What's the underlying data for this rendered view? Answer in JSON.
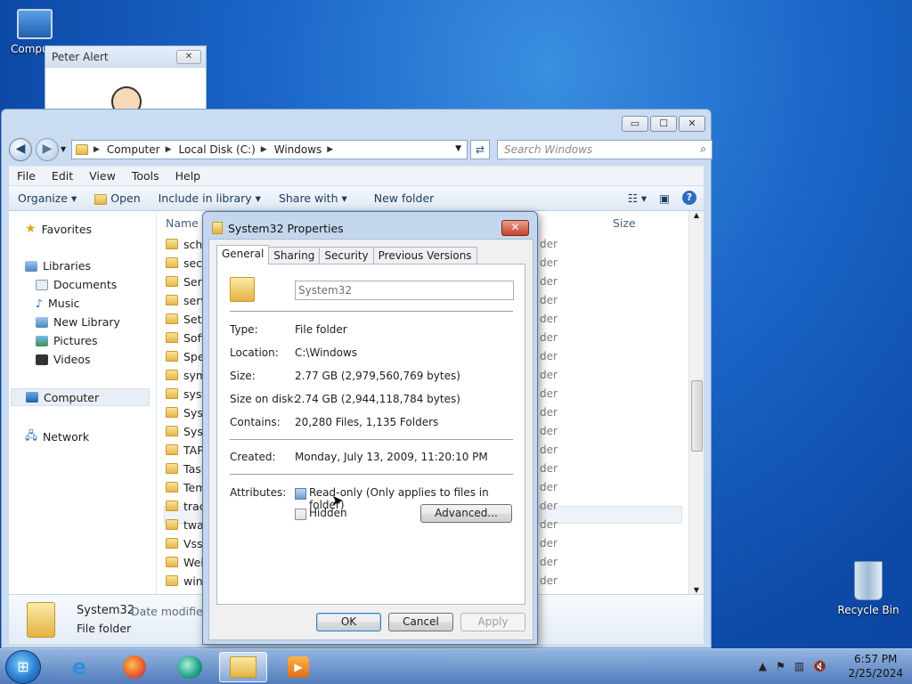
{
  "desktop": {
    "icons": [
      {
        "label": "Computer",
        "visible_label": "Compu"
      },
      {
        "label": "Recycle Bin"
      }
    ]
  },
  "peter_window": {
    "title": "Peter Alert",
    "close": "✕"
  },
  "explorer": {
    "controls": {
      "minimize": "▭",
      "maximize": "☐",
      "close": "✕"
    },
    "address": [
      "Computer",
      "Local Disk (C:)",
      "Windows"
    ],
    "search_placeholder": "Search Windows",
    "menu": [
      "File",
      "Edit",
      "View",
      "Tools",
      "Help"
    ],
    "toolbar": {
      "organize": "Organize ▾",
      "open": "Open",
      "include": "Include in library ▾",
      "share": "Share with ▾",
      "new_folder": "New folder"
    },
    "nav": {
      "favorites": "Favorites",
      "libraries": "Libraries",
      "documents": "Documents",
      "music": "Music",
      "new_library": "New Library",
      "pictures": "Pictures",
      "videos": "Videos",
      "computer": "Computer",
      "network": "Network"
    },
    "columns": {
      "name": "Name",
      "size": "Size"
    },
    "files": [
      "sche",
      "secu",
      "Serv",
      "serv",
      "Setu",
      "Soft",
      "Spee",
      "sym",
      "syst",
      "Syst",
      "SysV",
      "TAP",
      "Task",
      "Tem",
      "trac",
      "twai",
      "Vss",
      "Web",
      "wins"
    ],
    "type_text": "der",
    "details": {
      "name": "System32",
      "date_label": "Date modified:",
      "type": "File folder"
    }
  },
  "dialog": {
    "title": "System32 Properties",
    "close": "✕",
    "tabs": [
      "General",
      "Sharing",
      "Security",
      "Previous Versions"
    ],
    "name_value": "System32",
    "props": {
      "type_label": "Type:",
      "type_value": "File folder",
      "location_label": "Location:",
      "location_value": "C:\\Windows",
      "size_label": "Size:",
      "size_value": "2.77 GB (2,979,560,769 bytes)",
      "disk_label": "Size on disk:",
      "disk_value": "2.74 GB (2,944,118,784 bytes)",
      "contains_label": "Contains:",
      "contains_value": "20,280 Files, 1,135 Folders",
      "created_label": "Created:",
      "created_value": "Monday, July 13, 2009, 11:20:10 PM",
      "attributes_label": "Attributes:",
      "readonly_label": "Read-only (Only applies to files in folder)",
      "hidden_label": "Hidden",
      "advanced": "Advanced..."
    },
    "buttons": {
      "ok": "OK",
      "cancel": "Cancel",
      "apply": "Apply"
    }
  },
  "taskbar": {
    "time": "6:57 PM",
    "date": "2/25/2024"
  }
}
